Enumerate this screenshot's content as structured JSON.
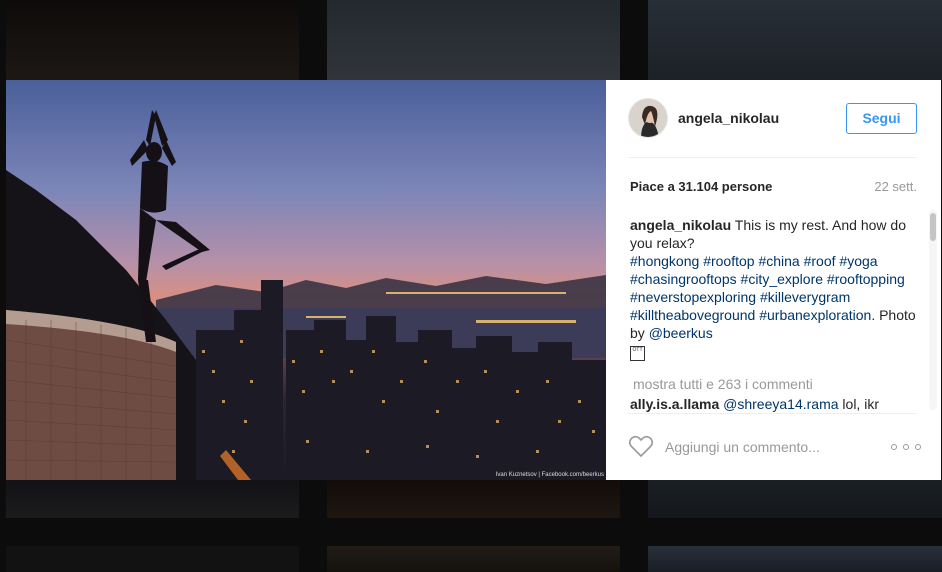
{
  "post": {
    "username": "angela_nikolau",
    "follow_label": "Segui",
    "likes_text": "Piace a 31.104 persone",
    "time_text": "22 sett.",
    "caption_user": "angela_nikolau",
    "caption_text": "This is my rest. And how do you relax?",
    "hashtags": [
      "#hongkong",
      "#rooftop",
      "#china",
      "#roof",
      "#yoga",
      "#chasingrooftops",
      "#city_explore",
      "#rooftopping",
      "#neverstopexploring",
      "#killeverygram",
      "#killtheaboveground",
      "#urbanexploration"
    ],
    "photo_by_label": "Photo by",
    "photo_by_user": "@beerkus",
    "emoji": "OTT",
    "show_all_comments": "mostra tutti e 263 i commenti",
    "comment_user": "ally.is.a.llama",
    "comment_mention": "@shreeya14.rama",
    "comment_text": "lol, ikr",
    "comment_placeholder": "Aggiungi un commento...",
    "photo_credit": "Ivan Kuznetsov | Facebook.com/beerkus"
  },
  "icons": {
    "heart": "heart-icon",
    "more": "more-options-icon"
  },
  "colors": {
    "accent": "#3897f0",
    "hashtag": "#003569",
    "muted": "#999999"
  }
}
